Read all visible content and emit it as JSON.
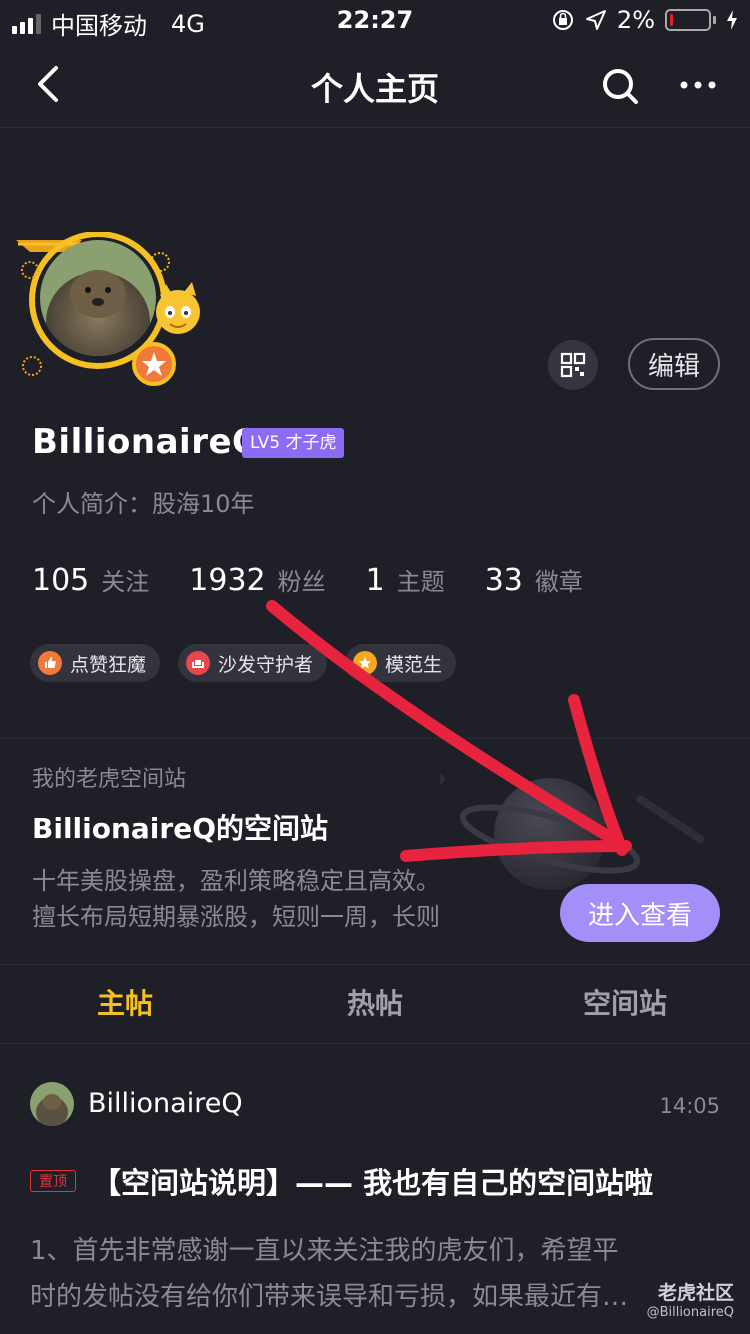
{
  "status_bar": {
    "carrier": "中国移动",
    "network": "4G",
    "time": "22:27",
    "battery": "2%"
  },
  "nav": {
    "title": "个人主页"
  },
  "profile": {
    "username": "BillionaireQ",
    "level": "LV5 才子虎",
    "bio": "个人简介：股海10年",
    "edit_label": "编辑",
    "stats": [
      {
        "num": "105",
        "label": "关注"
      },
      {
        "num": "1932",
        "label": "粉丝"
      },
      {
        "num": "1",
        "label": "主题"
      },
      {
        "num": "33",
        "label": "徽章"
      }
    ],
    "tags": [
      {
        "label": "点赞狂魔",
        "color": "#f07a3a"
      },
      {
        "label": "沙发守护者",
        "color": "#e8474e"
      },
      {
        "label": "模范生",
        "color": "#f5a623"
      }
    ]
  },
  "space": {
    "subtitle": "我的老虎空间站",
    "title": "BillionaireQ的空间站",
    "desc_line1": "十年美股操盘，盈利策略稳定且高效。",
    "desc_line2": "擅长布局短期暴涨股，短则一周，长则",
    "enter_label": "进入查看"
  },
  "tabs": [
    {
      "label": "主帖",
      "active": true
    },
    {
      "label": "热帖",
      "active": false
    },
    {
      "label": "空间站",
      "active": false
    }
  ],
  "post": {
    "author": "BillionaireQ",
    "time": "14:05",
    "pin_label": "置顶",
    "title": "【空间站说明】—— 我也有自己的空间站啦",
    "body_line1": "1、首先非常感谢一直以来关注我的虎友们，希望平",
    "body_line2": "时的发帖没有给你们带来误导和亏损，如果最近有…"
  },
  "watermark": {
    "logo": "老虎社区",
    "user": "@BillionaireQ"
  },
  "colors": {
    "background": "#1f1f28",
    "accent_yellow": "#f5c022",
    "accent_purple": "#a48ef7",
    "annotation_red": "#e8233d"
  }
}
